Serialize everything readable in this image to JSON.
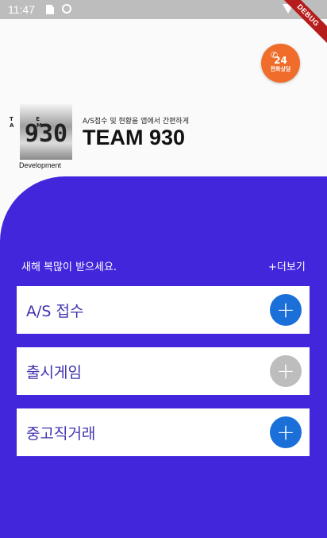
{
  "status_bar": {
    "time": "11:47",
    "icons": [
      "sim-card-icon",
      "at-icon",
      "wifi-icon",
      "signal-icon"
    ]
  },
  "debug_banner": "DEBUG",
  "call_button": {
    "number": "24",
    "label": "전화상담",
    "icon": "phone-icon",
    "color": "#ef6c2a"
  },
  "logo": {
    "letters": "T E A M",
    "number": "930",
    "caption": "Development"
  },
  "header": {
    "subtitle": "A/S접수 및 현황을 앱에서 간편하게",
    "title": "TEAM 930"
  },
  "panel": {
    "color": "#4126dc",
    "greeting": "새해 복많이 받으세요.",
    "more": "+더보기"
  },
  "cards": [
    {
      "label": "A/S 접수",
      "icon": "plus-icon",
      "button_color": "#1b6fd8"
    },
    {
      "label": "출시게임",
      "icon": "plus-icon",
      "button_color": "#bdbdbd"
    },
    {
      "label": "중고직거래",
      "icon": "plus-icon",
      "button_color": "#1b6fd8"
    }
  ]
}
